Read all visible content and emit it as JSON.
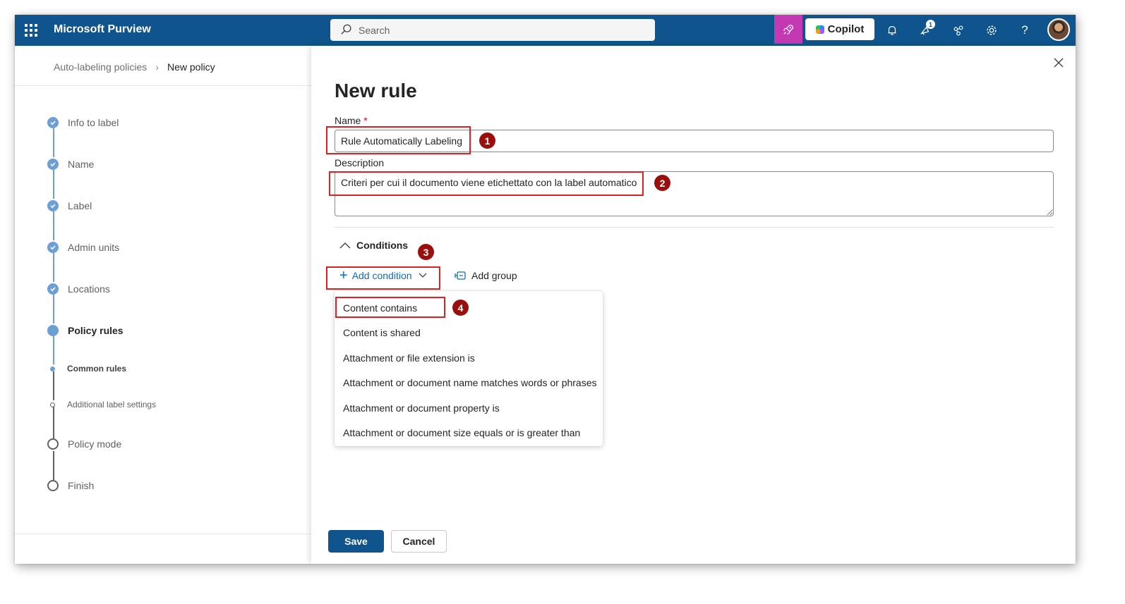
{
  "header": {
    "app_title": "Microsoft Purview",
    "search_placeholder": "Search",
    "copilot_label": "Copilot",
    "notification_badge": "1"
  },
  "breadcrumb": {
    "parent": "Auto-labeling policies",
    "current": "New policy"
  },
  "steps": [
    {
      "label": "Info to label",
      "state": "done"
    },
    {
      "label": "Name",
      "state": "done"
    },
    {
      "label": "Label",
      "state": "done"
    },
    {
      "label": "Admin units",
      "state": "done"
    },
    {
      "label": "Locations",
      "state": "done"
    },
    {
      "label": "Policy rules",
      "state": "current"
    },
    {
      "label": "Common rules",
      "state": "sub-done"
    },
    {
      "label": "Additional label settings",
      "state": "sub-pending"
    },
    {
      "label": "Policy mode",
      "state": "pending"
    },
    {
      "label": "Finish",
      "state": "pending"
    }
  ],
  "panel": {
    "title": "New rule",
    "name_label": "Name",
    "required_mark": "*",
    "name_value": "Rule Automatically Labeling",
    "description_label": "Description",
    "description_value": "Criteri per cui il documento viene etichettato con la label automatico",
    "conditions_label": "Conditions",
    "add_condition_label": "Add condition",
    "add_group_label": "Add group",
    "condition_options": [
      "Content contains",
      "Content is shared",
      "Attachment or file extension is",
      "Attachment or document name matches words or phrases",
      "Attachment or document property is",
      "Attachment or document size equals or is greater than"
    ],
    "save_label": "Save",
    "cancel_label": "Cancel"
  },
  "callouts": [
    "1",
    "2",
    "3",
    "4"
  ],
  "colors": {
    "topbar": "#0f548c",
    "accent": "#0f6cbd",
    "step_done": "#6c9fd6",
    "callout_box": "#e02020",
    "callout_number": "#9b0e0e"
  }
}
